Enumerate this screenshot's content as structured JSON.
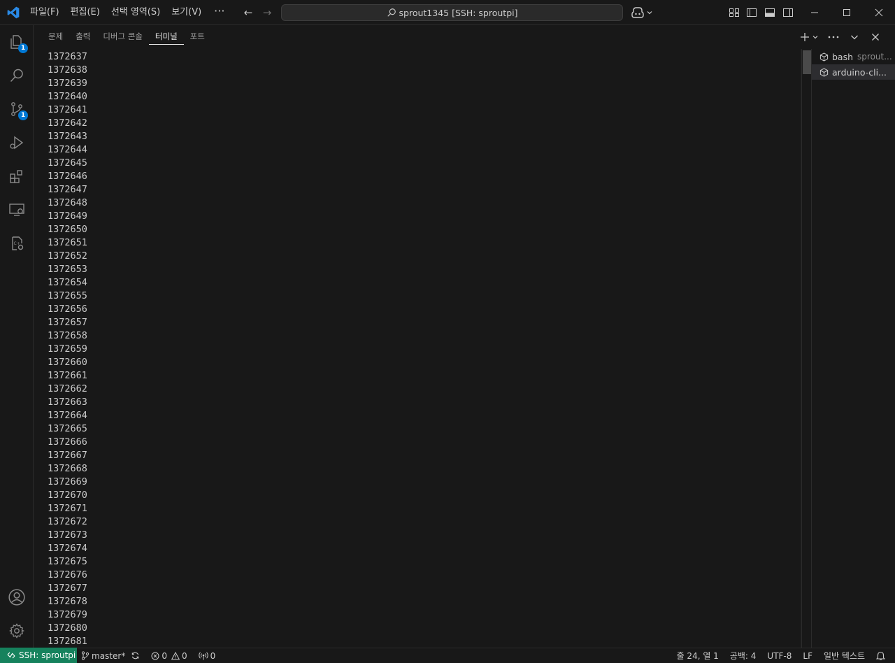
{
  "titlebar": {
    "menu": [
      "파일(F)",
      "편집(E)",
      "선택 영역(S)",
      "보기(V)"
    ],
    "more": "···",
    "command_center": "sprout1345 [SSH: sproutpi]"
  },
  "activity": {
    "explorer_badge": "1",
    "scm_badge": "1"
  },
  "panel": {
    "tabs": [
      "문제",
      "출력",
      "디버그 콘솔",
      "터미널",
      "포트"
    ],
    "active_tab": "터미널"
  },
  "terminal": {
    "lines": [
      "1372637",
      "1372638",
      "1372639",
      "1372640",
      "1372641",
      "1372642",
      "1372643",
      "1372644",
      "1372645",
      "1372646",
      "1372647",
      "1372648",
      "1372649",
      "1372650",
      "1372651",
      "1372652",
      "1372653",
      "1372654",
      "1372655",
      "1372656",
      "1372657",
      "1372658",
      "1372659",
      "1372660",
      "1372661",
      "1372662",
      "1372663",
      "1372664",
      "1372665",
      "1372666",
      "1372667",
      "1372668",
      "1372669",
      "1372670",
      "1372671",
      "1372672",
      "1372673",
      "1372674",
      "1372675",
      "1372676",
      "1372677",
      "1372678",
      "1372679",
      "1372680",
      "1372681"
    ],
    "list": [
      {
        "name": "bash",
        "sub": "sprout..."
      },
      {
        "name": "arduino-cli...",
        "sub": ""
      }
    ]
  },
  "statusbar": {
    "remote": "SSH: sproutpi",
    "branch": "master*",
    "errors": "0",
    "warnings": "0",
    "ports": "0",
    "position": "줄 24, 열 1",
    "spaces": "공백: 4",
    "encoding": "UTF-8",
    "eol": "LF",
    "language": "일반 텍스트"
  },
  "colors": {
    "accent": "#0078d4",
    "remote_bg": "#16825d",
    "vscode_blue": "#2a8ae6"
  }
}
